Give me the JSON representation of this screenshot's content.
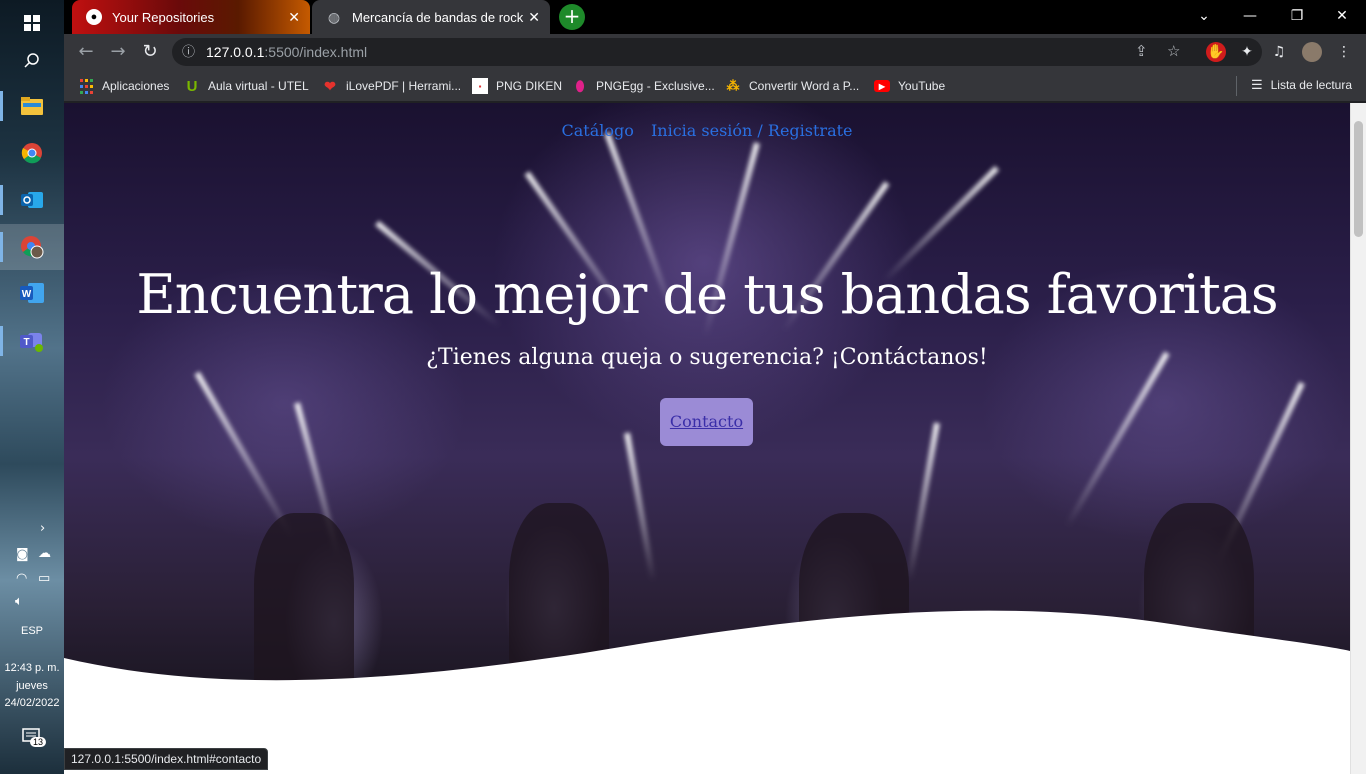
{
  "taskbar": {
    "time": "12:43 p. m.",
    "day": "jueves",
    "date": "24/02/2022",
    "language": "ESP",
    "notifications_count": "13",
    "apps": [
      "start-icon",
      "search-icon",
      "file-explorer-icon",
      "chrome-icon",
      "outlook-icon",
      "chrome-profile-icon",
      "word-icon",
      "teams-icon"
    ]
  },
  "tabs": [
    {
      "title": "Your Repositories",
      "icon": "github-icon"
    },
    {
      "title": "Mercancía de bandas de rock",
      "icon": "globe-icon"
    }
  ],
  "address_bar": {
    "host": "127.0.0.1",
    "rest": ":5500/index.html"
  },
  "bookmarks": [
    {
      "label": "Aplicaciones",
      "icon": "apps-grid-icon",
      "color": "#e8eaed"
    },
    {
      "label": "Aula virtual - UTEL",
      "icon": "utel-icon",
      "color": "#7ab800"
    },
    {
      "label": "iLovePDF | Herrami...",
      "icon": "ilovepdf-icon",
      "color": "#e5322d"
    },
    {
      "label": "PNG DIKEN",
      "icon": "pngdiken-icon",
      "color": "#ffffff"
    },
    {
      "label": "PNGEgg - Exclusive...",
      "icon": "pngegg-icon",
      "color": "#e0218a"
    },
    {
      "label": "Convertir Word a P...",
      "icon": "convert-icon",
      "color": "#f5b400"
    },
    {
      "label": "YouTube",
      "icon": "youtube-icon",
      "color": "#ff0000"
    }
  ],
  "reading_list": "Lista de lectura",
  "page": {
    "nav": {
      "catalog": "Catálogo",
      "login": "Inicia sesión / Registrate"
    },
    "headline": "Encuentra lo mejor de tus bandas favoritas",
    "subline": "¿Tienes alguna queja o sugerencia? ¡Contáctanos!",
    "cta": "Contacto",
    "accent": "#9b8bd6",
    "link_color": "#2a6fe0"
  },
  "status_url": "127.0.0.1:5500/index.html#contacto"
}
